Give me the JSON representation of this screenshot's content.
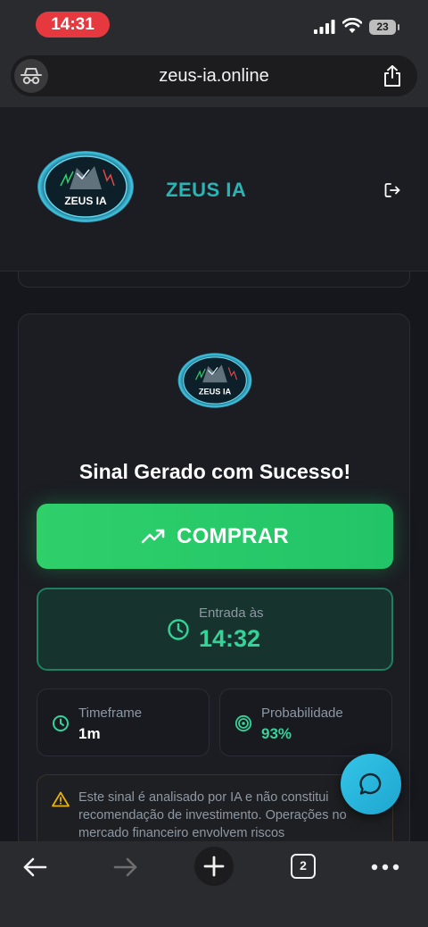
{
  "status_bar": {
    "time": "14:31",
    "battery": "23"
  },
  "browser": {
    "url": "zeus-ia.online",
    "tab_count": "2"
  },
  "header": {
    "brand": "ZEUS IA",
    "logo_text": "ZEUS IA"
  },
  "signal_card": {
    "logo_text": "ZEUS IA",
    "title": "Sinal Gerado com Sucesso!",
    "action_label": "COMPRAR",
    "entry_label": "Entrada às",
    "entry_time": "14:32",
    "timeframe_label": "Timeframe",
    "timeframe_value": "1m",
    "probability_label": "Probabilidade",
    "probability_value": "93%",
    "disclaimer": "Este sinal é analisado por IA e não constitui recomendação de investimento. Operações no mercado financeiro envolvem riscos"
  },
  "colors": {
    "accent_green": "#22c55e",
    "brand_teal": "#28b5b5",
    "chat_fab": "#2cb8de",
    "status_time_pill": "#e6383f"
  },
  "icons": [
    "incognito-icon",
    "share-icon",
    "logout-icon",
    "trending-up-icon",
    "clock-icon",
    "target-icon",
    "warning-icon",
    "chat-icon",
    "back-icon",
    "forward-icon",
    "plus-icon",
    "more-icon"
  ]
}
